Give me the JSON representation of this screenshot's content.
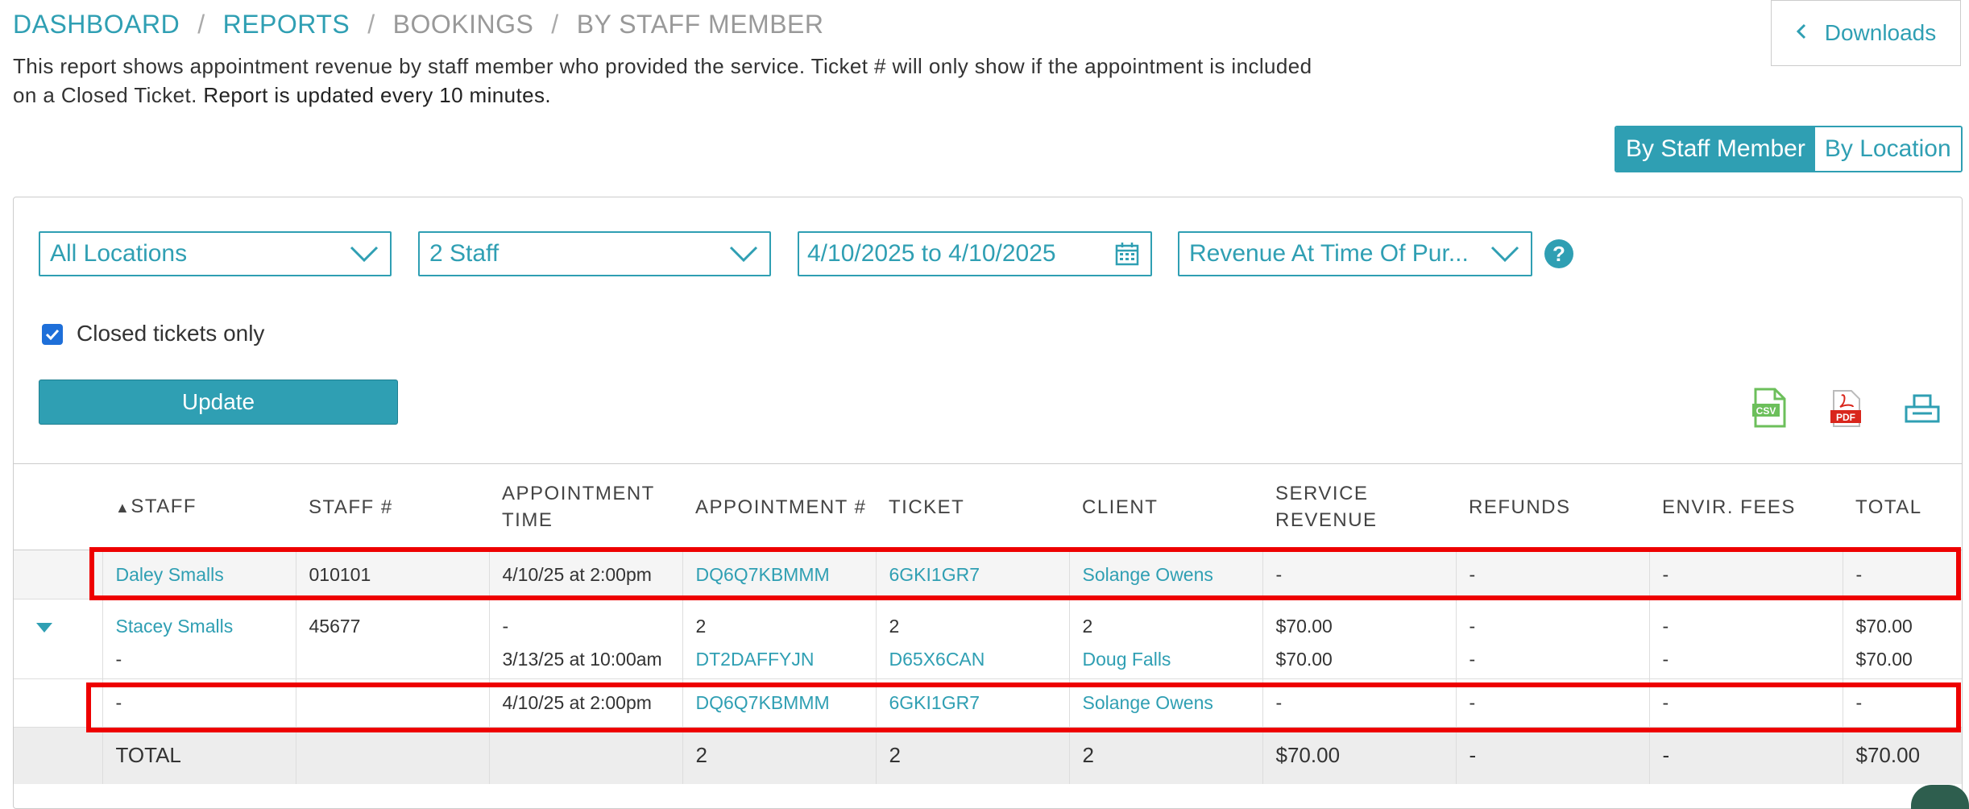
{
  "breadcrumb": {
    "dashboard": "DASHBOARD",
    "reports": "REPORTS",
    "bookings": "BOOKINGS",
    "current": "BY STAFF MEMBER",
    "separator": "/"
  },
  "description": {
    "text": "This report shows appointment revenue by staff member who provided the service. Ticket # will only show if the appointment is included on a Closed Ticket.",
    "bold": "Report is updated every 10 minutes."
  },
  "downloads_button": {
    "label": "Downloads",
    "icon": "chevron-left-icon"
  },
  "view_toggle": {
    "staff": "By Staff Member",
    "location": "By Location",
    "active": "staff"
  },
  "filters": {
    "locations": "All Locations",
    "staff": "2 Staff",
    "date_range": "4/10/2025 to 4/10/2025",
    "revenue_type": "Revenue At Time Of Pur...",
    "help": "?"
  },
  "closed_tickets": {
    "label": "Closed tickets only",
    "checked": true
  },
  "update_button": {
    "label": "Update"
  },
  "export_icons": {
    "csv_label": "CSV",
    "pdf_label": "PDF"
  },
  "table": {
    "sort_indicator": "▲",
    "headers": {
      "staff": "STAFF",
      "staff_num": "STAFF #",
      "appt_time_1": "APPOINTMENT",
      "appt_time_2": "TIME",
      "appt_num": "APPOINTMENT #",
      "ticket": "TICKET",
      "client": "CLIENT",
      "service_rev_1": "SERVICE",
      "service_rev_2": "REVENUE",
      "refunds": "REFUNDS",
      "envir_fees": "ENVIR. FEES",
      "total": "TOTAL"
    },
    "rows": [
      {
        "staff": "Daley Smalls",
        "staff_num": "010101",
        "appt_time": "4/10/25 at 2:00pm",
        "appt_num": "DQ6Q7KBMMM",
        "ticket": "6GKI1GR7",
        "client": "Solange Owens",
        "service_revenue": "-",
        "refunds": "-",
        "envir_fees": "-",
        "total": "-"
      },
      {
        "staff": "Stacey Smalls",
        "staff_num": "45677",
        "appt_time": "-",
        "appt_num": "2",
        "ticket": "2",
        "client": "2",
        "service_revenue": "$70.00",
        "refunds": "-",
        "envir_fees": "-",
        "total": "$70.00"
      },
      {
        "staff": "-",
        "staff_num": "",
        "appt_time": "3/13/25 at 10:00am",
        "appt_num": "DT2DAFFYJN",
        "ticket": "D65X6CAN",
        "client": "Doug Falls",
        "service_revenue": "$70.00",
        "refunds": "-",
        "envir_fees": "-",
        "total": "$70.00"
      },
      {
        "staff": "-",
        "staff_num": "",
        "appt_time": "4/10/25 at 2:00pm",
        "appt_num": "DQ6Q7KBMMM",
        "ticket": "6GKI1GR7",
        "client": "Solange Owens",
        "service_revenue": "-",
        "refunds": "-",
        "envir_fees": "-",
        "total": "-"
      }
    ],
    "totals": {
      "label": "TOTAL",
      "appt_num": "2",
      "ticket": "2",
      "client": "2",
      "service_revenue": "$70.00",
      "refunds": "-",
      "envir_fees": "-",
      "total": "$70.00"
    }
  },
  "colors": {
    "accent": "#2f9fb3",
    "highlight": "#ee0000",
    "checkbox": "#1e6fd9"
  }
}
